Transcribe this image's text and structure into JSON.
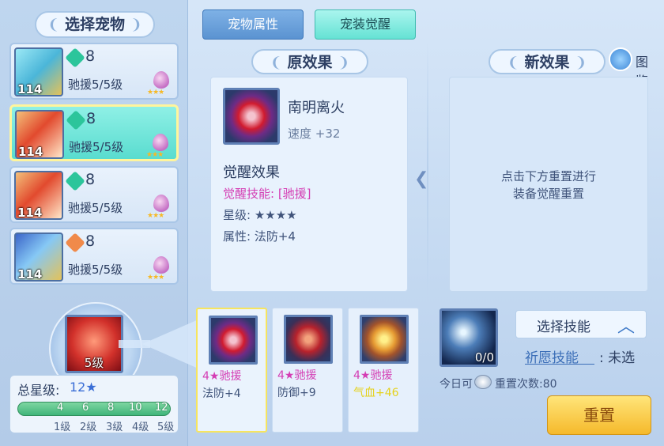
{
  "left": {
    "title": "选择宠物",
    "pets": [
      {
        "gem_value": "8",
        "gem_color": "#2cc59b",
        "help": "驰援5/5级",
        "level": "114",
        "selected": false
      },
      {
        "gem_value": "8",
        "gem_color": "#2cc59b",
        "help": "驰援5/5级",
        "level": "114",
        "selected": true
      },
      {
        "gem_value": "8",
        "gem_color": "#2cc59b",
        "help": "驰援5/5级",
        "level": "114",
        "selected": false
      },
      {
        "gem_value": "8",
        "gem_color": "#f08a4a",
        "help": "驰援5/5级",
        "level": "114",
        "selected": false
      }
    ],
    "skill_level": "5级",
    "total_stars_label": "总星级:",
    "total_stars_value": "12★",
    "bar_ticks": [
      "4",
      "6",
      "8",
      "10",
      "12"
    ],
    "level_ticks": [
      "1级",
      "2级",
      "3级",
      "4级",
      "5级"
    ]
  },
  "tabs": {
    "attributes": "宠物属性",
    "awaken": "宠装觉醒"
  },
  "original": {
    "title": "原效果",
    "item_name": "南明离火",
    "item_stat": "速度 +32",
    "awaken_title": "觉醒效果",
    "awaken_skill": "觉醒技能: [驰援]",
    "star_label": "星级: ★★★★",
    "attribute": "属性: 法防+4"
  },
  "new_effect": {
    "title": "新效果",
    "atlas": "图鉴",
    "hint_line1": "点击下方重置进行",
    "hint_line2": "装备觉醒重置"
  },
  "slots": [
    {
      "title": "4★驰援",
      "attr": "法防+4",
      "highlight": false,
      "selected": true
    },
    {
      "title": "4★驰援",
      "attr": "防御+9",
      "highlight": false,
      "selected": false
    },
    {
      "title": "4★驰援",
      "attr": "气血+46",
      "highlight": true,
      "selected": false
    }
  ],
  "reset": {
    "orb_count": "0/0",
    "choose_skill": "选择技能",
    "wish_label": "祈愿技能",
    "wish_value": ": 未选",
    "today_label": "今日可",
    "reset_count": "重置次数:80",
    "reset_button": "重置"
  }
}
